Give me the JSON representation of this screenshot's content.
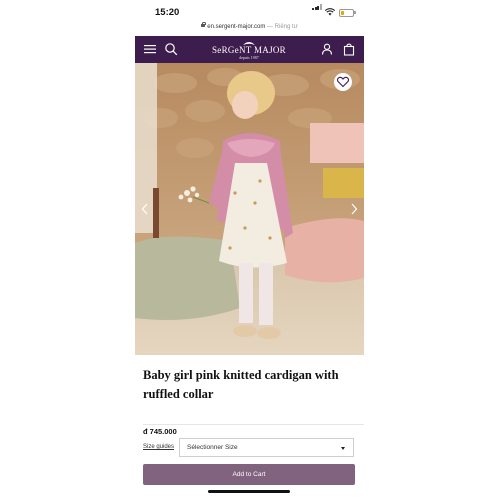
{
  "status_bar": {
    "time": "15:20"
  },
  "browser": {
    "url": "en.sergent-major.com",
    "secure_label": "— Riêng tư"
  },
  "nav": {
    "brand": "SeRGeNT MAJOR",
    "brand_tagline": "depuis 1987",
    "icons": [
      "menu-icon",
      "search-icon",
      "account-icon",
      "bag-icon"
    ]
  },
  "product": {
    "title": "Baby girl pink knitted cardigan with ruffled collar",
    "price": "đ 745.000",
    "size_guides_label": "Size guides",
    "size_select_value": "Sélectionner Size",
    "add_to_cart_label": "Add to Cart"
  },
  "colors": {
    "nav_bg": "#3d1d4e",
    "button_bg": "#82637f"
  }
}
